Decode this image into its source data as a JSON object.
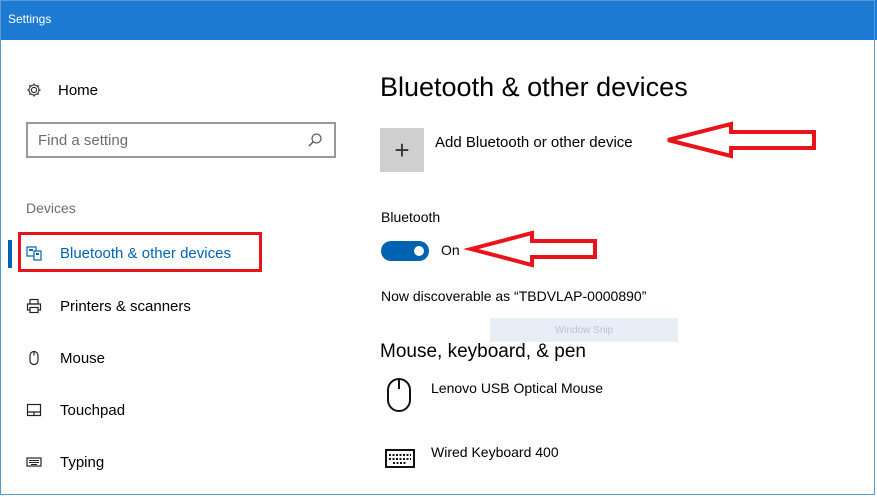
{
  "window": {
    "title": "Settings"
  },
  "sidebar": {
    "home_label": "Home",
    "search_placeholder": "Find a setting",
    "section_label": "Devices",
    "items": [
      {
        "label": "Bluetooth & other devices",
        "icon": "bluetooth-devices-icon",
        "active": true
      },
      {
        "label": "Printers & scanners",
        "icon": "printer-icon"
      },
      {
        "label": "Mouse",
        "icon": "mouse-icon"
      },
      {
        "label": "Touchpad",
        "icon": "touchpad-icon"
      },
      {
        "label": "Typing",
        "icon": "keyboard-icon"
      }
    ]
  },
  "main": {
    "title": "Bluetooth & other devices",
    "add_device_label": "Add Bluetooth or other device",
    "bluetooth_label": "Bluetooth",
    "bluetooth_state": "On",
    "discoverable_text": "Now discoverable as “TBDVLAP-0000890”",
    "overlay_text": "Window Snip",
    "section_title": "Mouse, keyboard, & pen",
    "devices": [
      {
        "name": "Lenovo USB Optical Mouse",
        "icon": "mouse-icon"
      },
      {
        "name": "Wired Keyboard 400",
        "icon": "keyboard-icon"
      }
    ]
  },
  "annotations": {
    "highlight_color": "#e8141a",
    "accent_color": "#0063b1"
  }
}
